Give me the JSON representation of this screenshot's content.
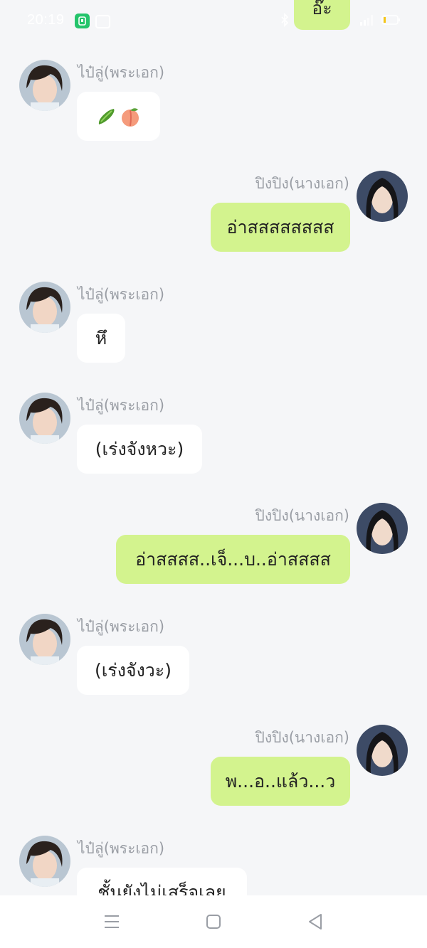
{
  "status_bar": {
    "time": "20:19"
  },
  "chat": {
    "clipped_top_message": "อ๊ะ",
    "messages": [
      {
        "side": "left",
        "sender": "ไป๋ลู่(พระเอก)",
        "text": "",
        "emoji": [
          "cucumber-emoji",
          "peach-emoji"
        ]
      },
      {
        "side": "right",
        "sender": "ปิงปิง(นางเอก)",
        "text": "อ่าสสสสสสสส"
      },
      {
        "side": "left",
        "sender": "ไป๋ลู่(พระเอก)",
        "text": "หึ"
      },
      {
        "side": "left",
        "sender": "ไป๋ลู่(พระเอก)",
        "text": "(เร่งจังหวะ)"
      },
      {
        "side": "right",
        "sender": "ปิงปิง(นางเอก)",
        "text": "อ่าสสสส..เจ็...บ..อ่าสสสส"
      },
      {
        "side": "left",
        "sender": "ไป๋ลู่(พระเอก)",
        "text": "(เร่งจังวะ)"
      },
      {
        "side": "right",
        "sender": "ปิงปิง(นางเอก)",
        "text": "พ...อ..แล้ว...ว"
      },
      {
        "side": "left",
        "sender": "ไป๋ลู่(พระเอก)",
        "text": "ชั้นยังไม่เสร็จเลย"
      }
    ]
  },
  "colors": {
    "background": "#f5f6f8",
    "incoming_bubble": "#ffffff",
    "outgoing_bubble": "#d3f38e",
    "sender_text": "#9a9ea5"
  },
  "icons": {
    "nav": [
      "menu-icon",
      "home-square-icon",
      "back-triangle-icon"
    ]
  }
}
